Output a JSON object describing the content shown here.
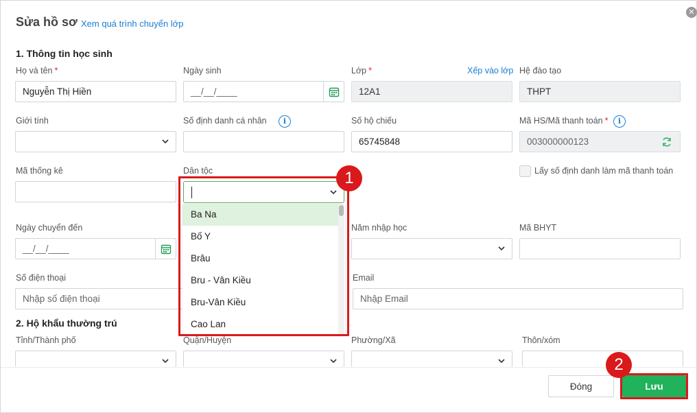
{
  "dialog": {
    "title": "Sửa hồ sơ",
    "title_link": "Xem quá trình chuyển lớp",
    "close_icon": "close-icon"
  },
  "sections": {
    "student_info": "1. Thông tin học sinh",
    "permanent_address": "2. Hộ khẩu thường trú"
  },
  "fields": {
    "full_name": {
      "label": "Họ và tên",
      "required": "*",
      "value": "Nguyễn Thị Hiền"
    },
    "dob": {
      "label": "Ngày sinh",
      "value": "__/__/____"
    },
    "class": {
      "label": "Lớp",
      "required": "*",
      "value": "12A1",
      "link": "Xếp vào lớp"
    },
    "education_system": {
      "label": "Hệ đào tạo",
      "value": "THPT"
    },
    "gender": {
      "label": "Giới tính",
      "value": ""
    },
    "personal_id": {
      "label": "Số định danh cá nhân",
      "value": ""
    },
    "passport": {
      "label": "Số hộ chiếu",
      "value": "65745848"
    },
    "student_code": {
      "label": "Mã HS/Mã thanh toán",
      "required": "*",
      "value": "003000000123"
    },
    "stat_code": {
      "label": "Mã thống kê",
      "value": ""
    },
    "ethnicity": {
      "label": "Dân tộc",
      "value": "",
      "options": [
        "Ba Na",
        "Bố Y",
        "Brâu",
        "Bru - Vân Kiều",
        "Bru-Vân Kiều",
        "Cao Lan"
      ],
      "selected_option": "Ba Na"
    },
    "use_id_checkbox": {
      "label": "Lấy số định danh làm mã thanh toán",
      "checked": false
    },
    "transfer_date": {
      "label": "Ngày chuyển đến",
      "value": "__/__/____"
    },
    "enroll_year": {
      "label": "Năm nhập học",
      "value": ""
    },
    "health_insurance": {
      "label": "Mã BHYT",
      "value": ""
    },
    "phone": {
      "label": "Số điện thoại",
      "placeholder": "Nhập số điện thoại"
    },
    "email": {
      "label": "Email",
      "placeholder": "Nhập Email"
    },
    "province": {
      "label": "Tỉnh/Thành phố",
      "value": ""
    },
    "district": {
      "label": "Quận/Huyện",
      "value": ""
    },
    "ward": {
      "label": "Phường/Xã",
      "value": ""
    },
    "hamlet": {
      "label": "Thôn/xóm",
      "value": ""
    }
  },
  "annotations": {
    "step1": "1",
    "step2": "2"
  },
  "buttons": {
    "close": "Đóng",
    "save": "Lưu"
  },
  "colors": {
    "accent_link": "#1a7fd1",
    "save_green": "#21b25c",
    "highlight_red": "#d9191c",
    "selected_option_bg": "#dff1df"
  }
}
